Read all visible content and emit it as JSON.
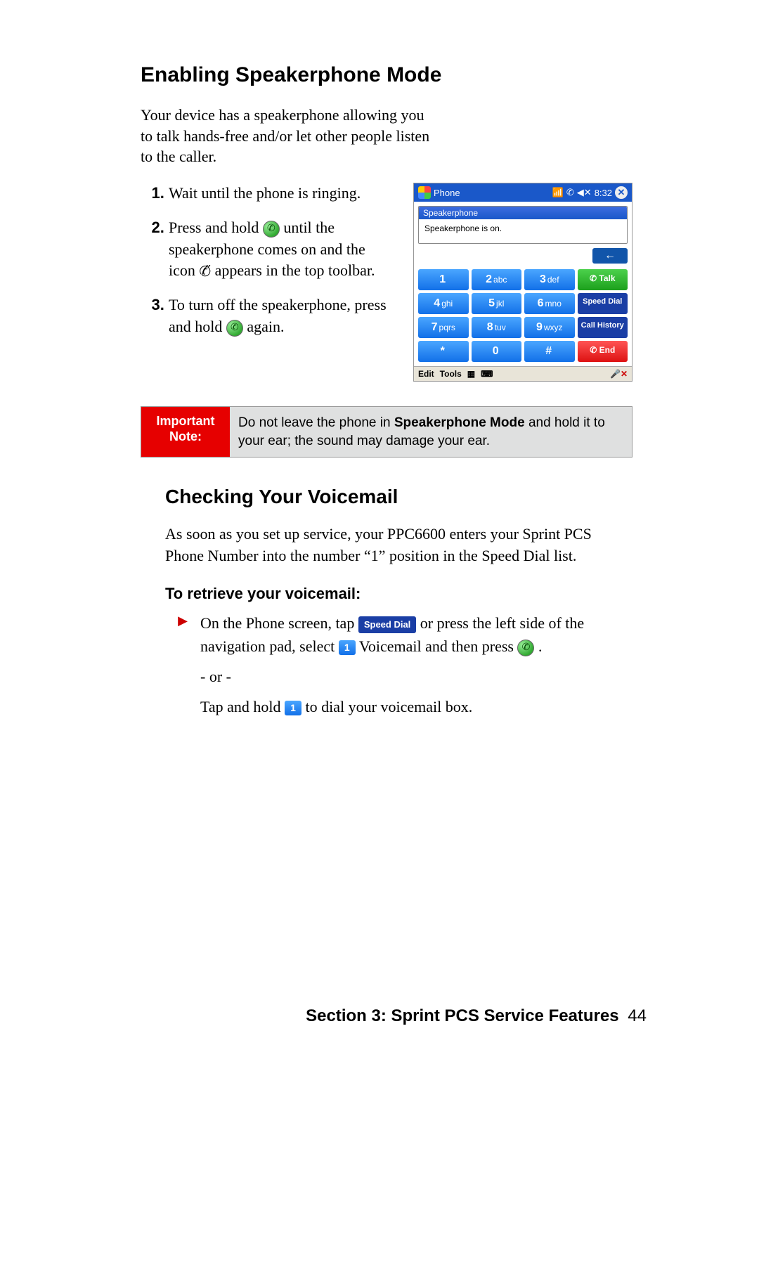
{
  "heading1": "Enabling Speakerphone Mode",
  "intro": "Your device has a speakerphone allowing you to talk hands-free and/or let other people listen to the caller.",
  "steps": {
    "s1": "Wait  until  the phone is ringing.",
    "s2a": "Press and hold ",
    "s2b": " until the speakerphone comes on and the icon ",
    "s2c": " appears in the top toolbar.",
    "s3a": "To turn off the speakerphone, press  and hold ",
    "s3b": " again."
  },
  "phone": {
    "title": "Phone",
    "time": "8:32",
    "popup_title": "Speakerphone",
    "popup_body": "Speakerphone is on.",
    "keys": {
      "k1": "1",
      "k2n": "2",
      "k2t": "abc",
      "k3n": "3",
      "k3t": "def",
      "talk": "Talk",
      "k4n": "4",
      "k4t": "ghi",
      "k5n": "5",
      "k5t": "jkl",
      "k6n": "6",
      "k6t": "mno",
      "speed": "Speed Dial",
      "k7n": "7",
      "k7t": "pqrs",
      "k8n": "8",
      "k8t": "tuv",
      "k9n": "9",
      "k9t": "wxyz",
      "hist": "Call History",
      "star": "*",
      "k0": "0",
      "hash": "#",
      "end": "End"
    },
    "bottom": {
      "edit": "Edit",
      "tools": "Tools"
    }
  },
  "note": {
    "label": "Important Note:",
    "t1": "Do not leave the phone in ",
    "bold": "Speakerphone Mode",
    "t2": " and hold it to your ear; the sound may damage your ear."
  },
  "heading2": "Checking Your Voicemail",
  "vm_para": "As soon as you set up service, your PPC6600 enters your Sprint PCS Phone Number into the number “1” position in the Speed Dial list.",
  "subhead": "To retrieve your voicemail:",
  "retrieve": {
    "a": "On the Phone screen, tap ",
    "sd": "Speed Dial",
    "b": " or press the left side of the navigation pad, select ",
    "one": "1",
    "c": " Voicemail and then press ",
    "d": ".",
    "or": "- or -",
    "e": "Tap and hold ",
    "f": "  to dial your voicemail box."
  },
  "footer": {
    "section": "Section 3: Sprint PCS Service Features",
    "page": "44"
  }
}
